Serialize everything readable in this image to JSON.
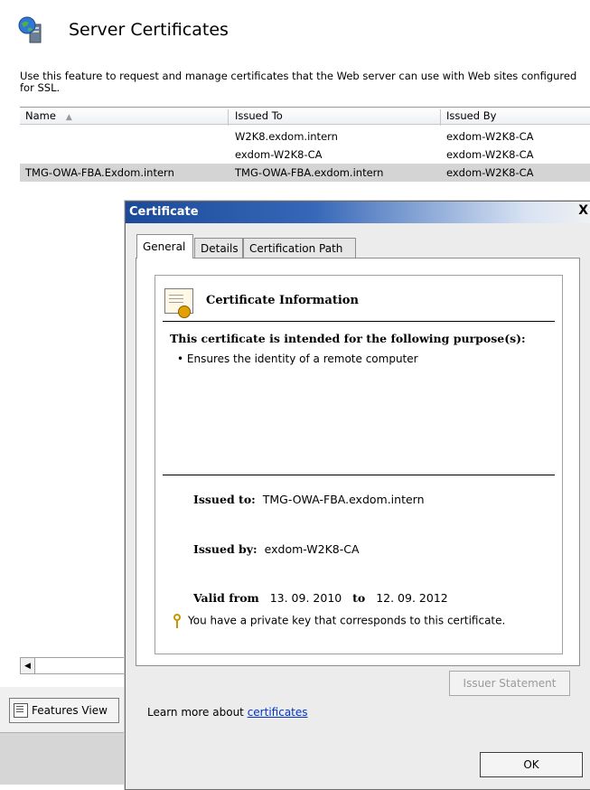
{
  "page": {
    "title": "Server Certificates",
    "description": "Use this feature to request and manage certificates that the Web server can use with Web sites configured for SSL."
  },
  "grid": {
    "columns": [
      "Name",
      "Issued To",
      "Issued By"
    ],
    "sort_indicator": "▲",
    "rows": [
      {
        "name": "",
        "issued_to": "W2K8.exdom.intern",
        "issued_by": "exdom-W2K8-CA"
      },
      {
        "name": "",
        "issued_to": "exdom-W2K8-CA",
        "issued_by": "exdom-W2K8-CA"
      },
      {
        "name": "TMG-OWA-FBA.Exdom.intern",
        "issued_to": "TMG-OWA-FBA.exdom.intern",
        "issued_by": "exdom-W2K8-CA"
      }
    ]
  },
  "views": {
    "features_view": "Features View"
  },
  "dialog": {
    "title": "Certificate",
    "close": "X",
    "tabs": [
      "General",
      "Details",
      "Certification Path"
    ],
    "info_title": "Certificate Information",
    "purpose_heading": "This certificate is intended for the following purpose(s):",
    "purposes": [
      "• Ensures the identity of a remote computer"
    ],
    "issued_to_label": "Issued to:",
    "issued_to": "TMG-OWA-FBA.exdom.intern",
    "issued_by_label": "Issued by:",
    "issued_by": "exdom-W2K8-CA",
    "valid_from_label": "Valid from",
    "valid_from": "13. 09. 2010",
    "to_label": "to",
    "valid_to": "12. 09. 2012",
    "private_key_note": "You have a private key that corresponds to this certificate.",
    "issuer_statement": "Issuer Statement",
    "learn_more_text": "Learn more about ",
    "learn_more_link": "certificates",
    "ok": "OK"
  }
}
